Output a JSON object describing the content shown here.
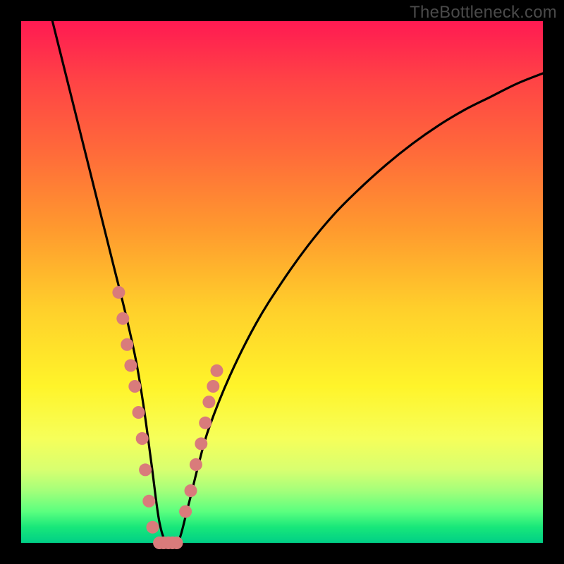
{
  "watermark": "TheBottleneck.com",
  "colors": {
    "curve_stroke": "#000000",
    "marker_fill": "#d97b7b",
    "marker_stroke": "#c96a6a"
  },
  "chart_data": {
    "type": "line",
    "title": "",
    "xlabel": "",
    "ylabel": "",
    "xlim": [
      0,
      100
    ],
    "ylim": [
      0,
      100
    ],
    "grid": false,
    "series": [
      {
        "name": "bottleneck-curve",
        "x": [
          6,
          8,
          10,
          12,
          14,
          16,
          18,
          20,
          22,
          23.5,
          25,
          26.5,
          28,
          30,
          32,
          34,
          36,
          40,
          45,
          50,
          55,
          60,
          65,
          70,
          75,
          80,
          85,
          90,
          95,
          100
        ],
        "y": [
          100,
          92,
          84,
          76,
          68,
          60,
          52,
          44,
          35,
          26,
          15,
          4,
          0,
          0,
          7,
          15,
          22,
          32,
          42,
          50,
          57,
          63,
          68,
          72.5,
          76.5,
          80,
          83,
          85.5,
          88,
          90
        ]
      }
    ],
    "markers": {
      "left_cluster": {
        "x": [
          18.7,
          19.5,
          20.3,
          21.0,
          21.8,
          22.5,
          23.2,
          23.8,
          24.5,
          25.2
        ],
        "y": [
          48,
          43,
          38,
          34,
          30,
          25,
          20,
          14,
          8,
          3
        ]
      },
      "bottom_cluster": {
        "x": [
          26.5,
          27.3,
          28.2,
          29.0,
          29.8
        ],
        "y": [
          0,
          0,
          0,
          0,
          0
        ]
      },
      "right_cluster": {
        "x": [
          31.5,
          32.5,
          33.5,
          34.5,
          35.3,
          36.0,
          36.8,
          37.5
        ],
        "y": [
          6,
          10,
          15,
          19,
          23,
          27,
          30,
          33
        ]
      }
    },
    "marker_radius_px": 9
  }
}
